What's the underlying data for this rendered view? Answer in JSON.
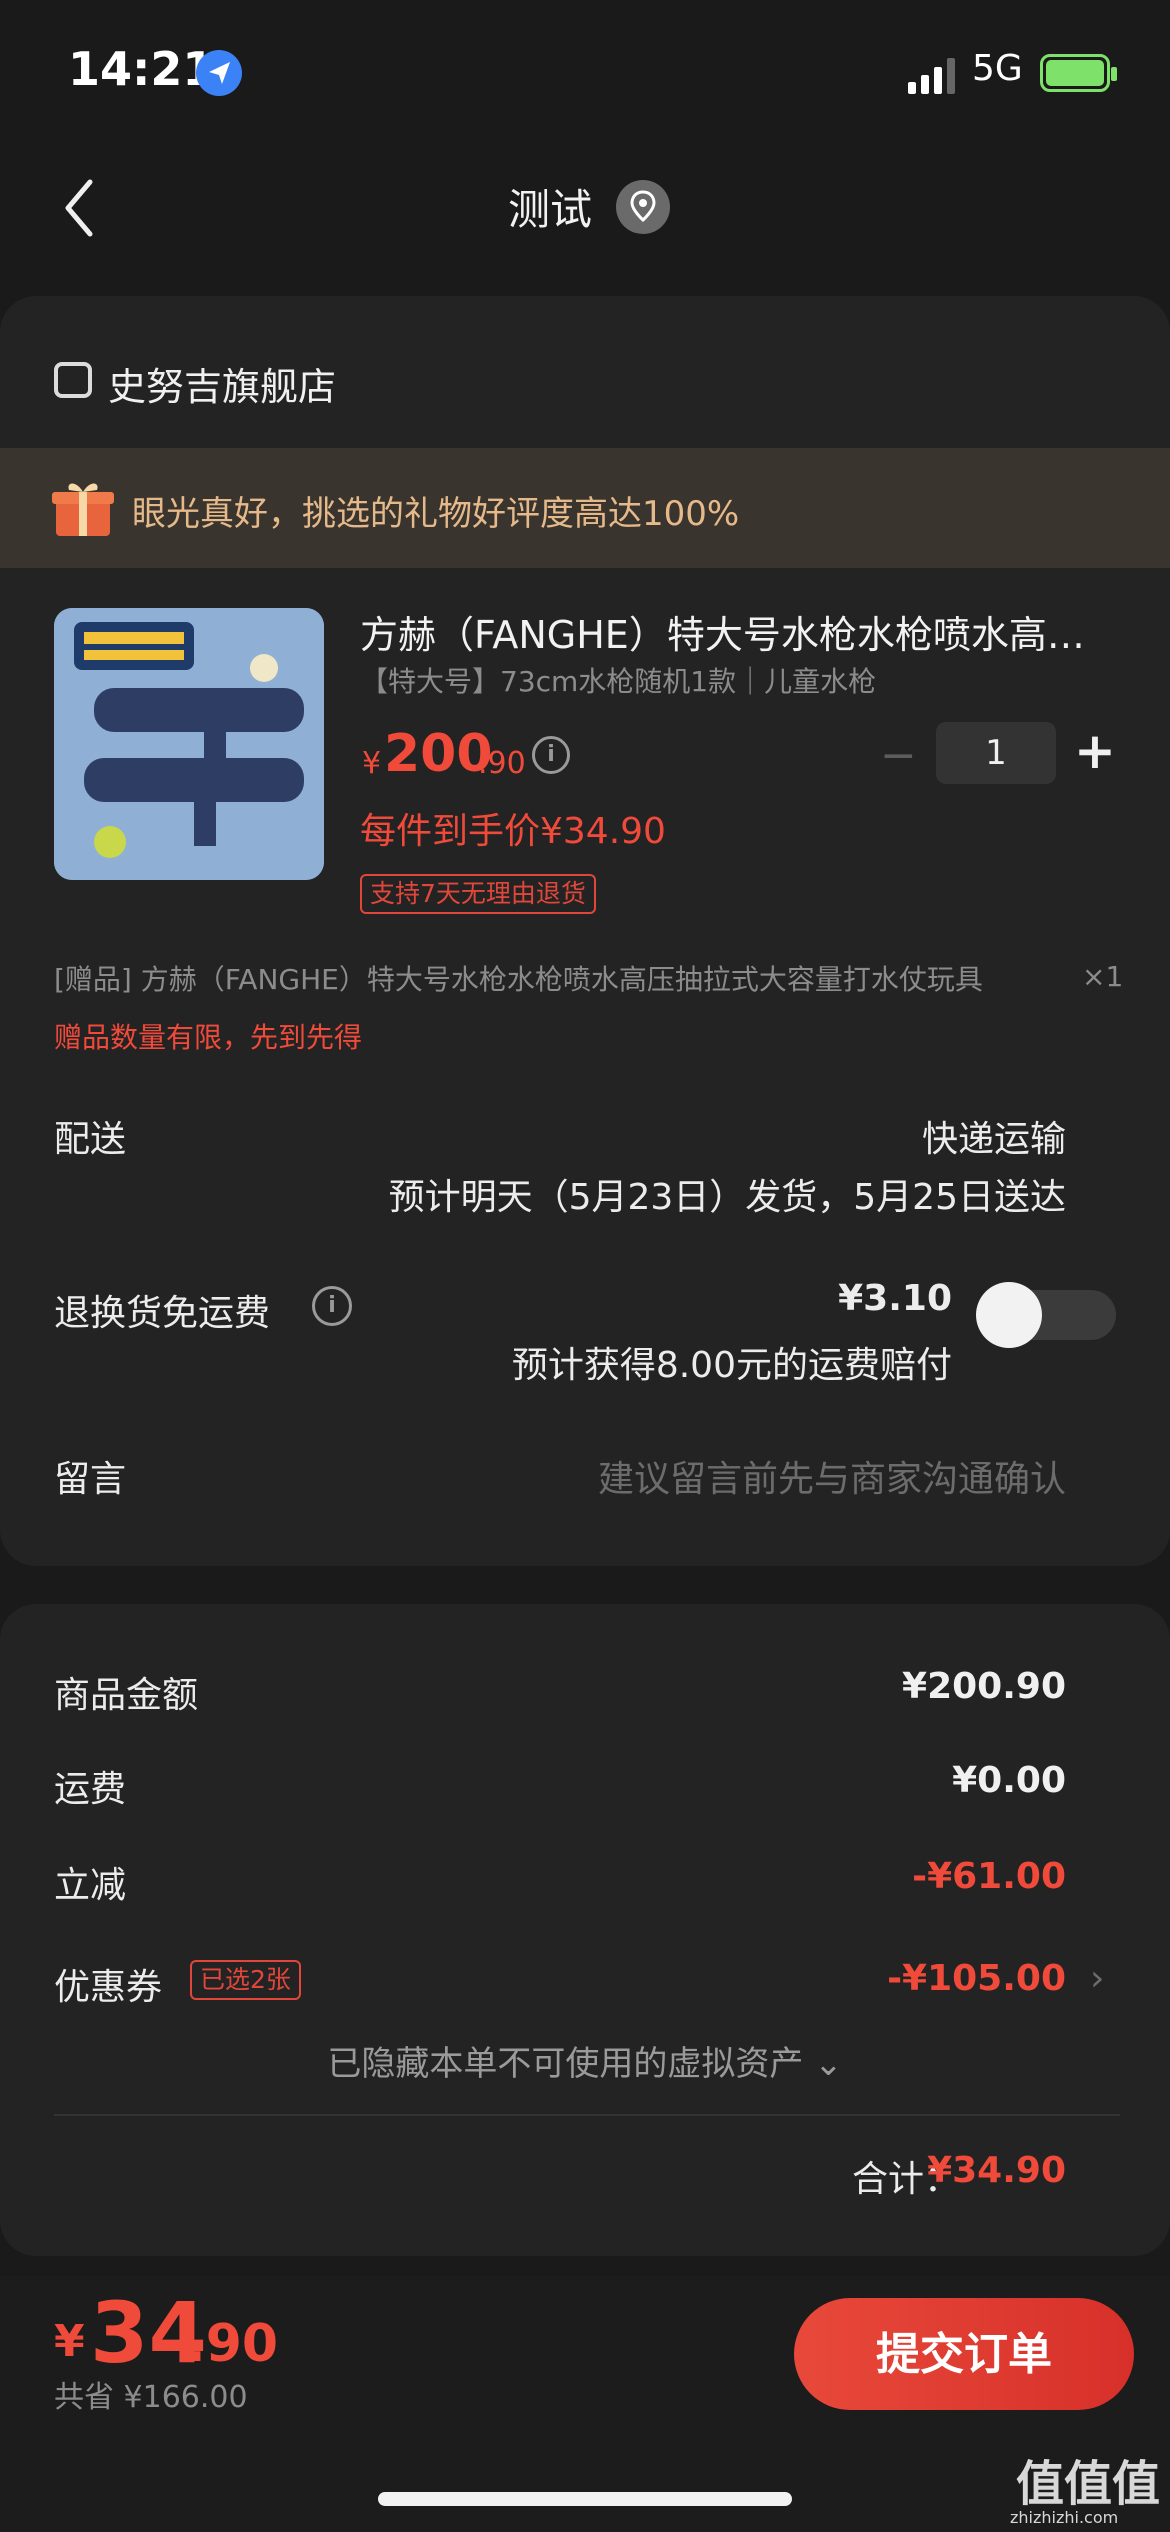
{
  "status_bar": {
    "time": "14:21",
    "network": "5G"
  },
  "nav": {
    "title": "测试"
  },
  "shop": {
    "name": "史努吉旗舰店"
  },
  "promo": {
    "text": "眼光真好，挑选的礼物好评度高达100%"
  },
  "product": {
    "title": "方赫（FANGHE）特大号水枪水枪喷水高压抽拉式大容量打水仗",
    "spec": "【特大号】73cm水枪随机1款｜儿童水枪",
    "currency": "¥",
    "price_int": "200",
    "price_dec": ".90",
    "quantity": "1",
    "minus": "−",
    "plus": "+",
    "unit_price": "每件到手价¥34.90",
    "return_tag": "支持7天无理由退货"
  },
  "gift": {
    "line": "[赠品] 方赫（FANGHE）特大号水枪水枪喷水高压抽拉式大容量打水仗玩具",
    "qty": "×1",
    "limit": "赠品数量有限，先到先得"
  },
  "delivery": {
    "label": "配送",
    "method": "快递运输",
    "estimate": "预计明天（5月23日）发货，5月25日送达"
  },
  "return_shipping": {
    "label": "退换货免运费",
    "price": "¥3.10",
    "compensation": "预计获得8.00元的运费赔付",
    "enabled": false
  },
  "note": {
    "label": "留言",
    "placeholder": "建议留言前先与商家沟通确认"
  },
  "summary": {
    "goods_label": "商品金额",
    "goods_value": "¥200.90",
    "shipping_label": "运费",
    "shipping_value": "¥0.00",
    "discount_label": "立减",
    "discount_value": "-¥61.00",
    "coupon_label": "优惠券",
    "coupon_tag": "已选2张",
    "coupon_value": "-¥105.00",
    "hidden_assets": "已隐藏本单不可使用的虚拟资产 ⌄",
    "total_label": "合计：",
    "total_value": "¥34.90"
  },
  "checkout": {
    "currency": "¥",
    "pay_int": "34",
    "pay_dec": ".90",
    "saved": "共省 ¥166.00",
    "submit_label": "提交订单"
  },
  "watermark": {
    "main": "值值值",
    "sub": "zhizhizhi.com"
  },
  "colors": {
    "accent": "#f04a3a",
    "background": "#1a1a1a",
    "card": "#232323",
    "promo_text": "#e6b98a"
  }
}
